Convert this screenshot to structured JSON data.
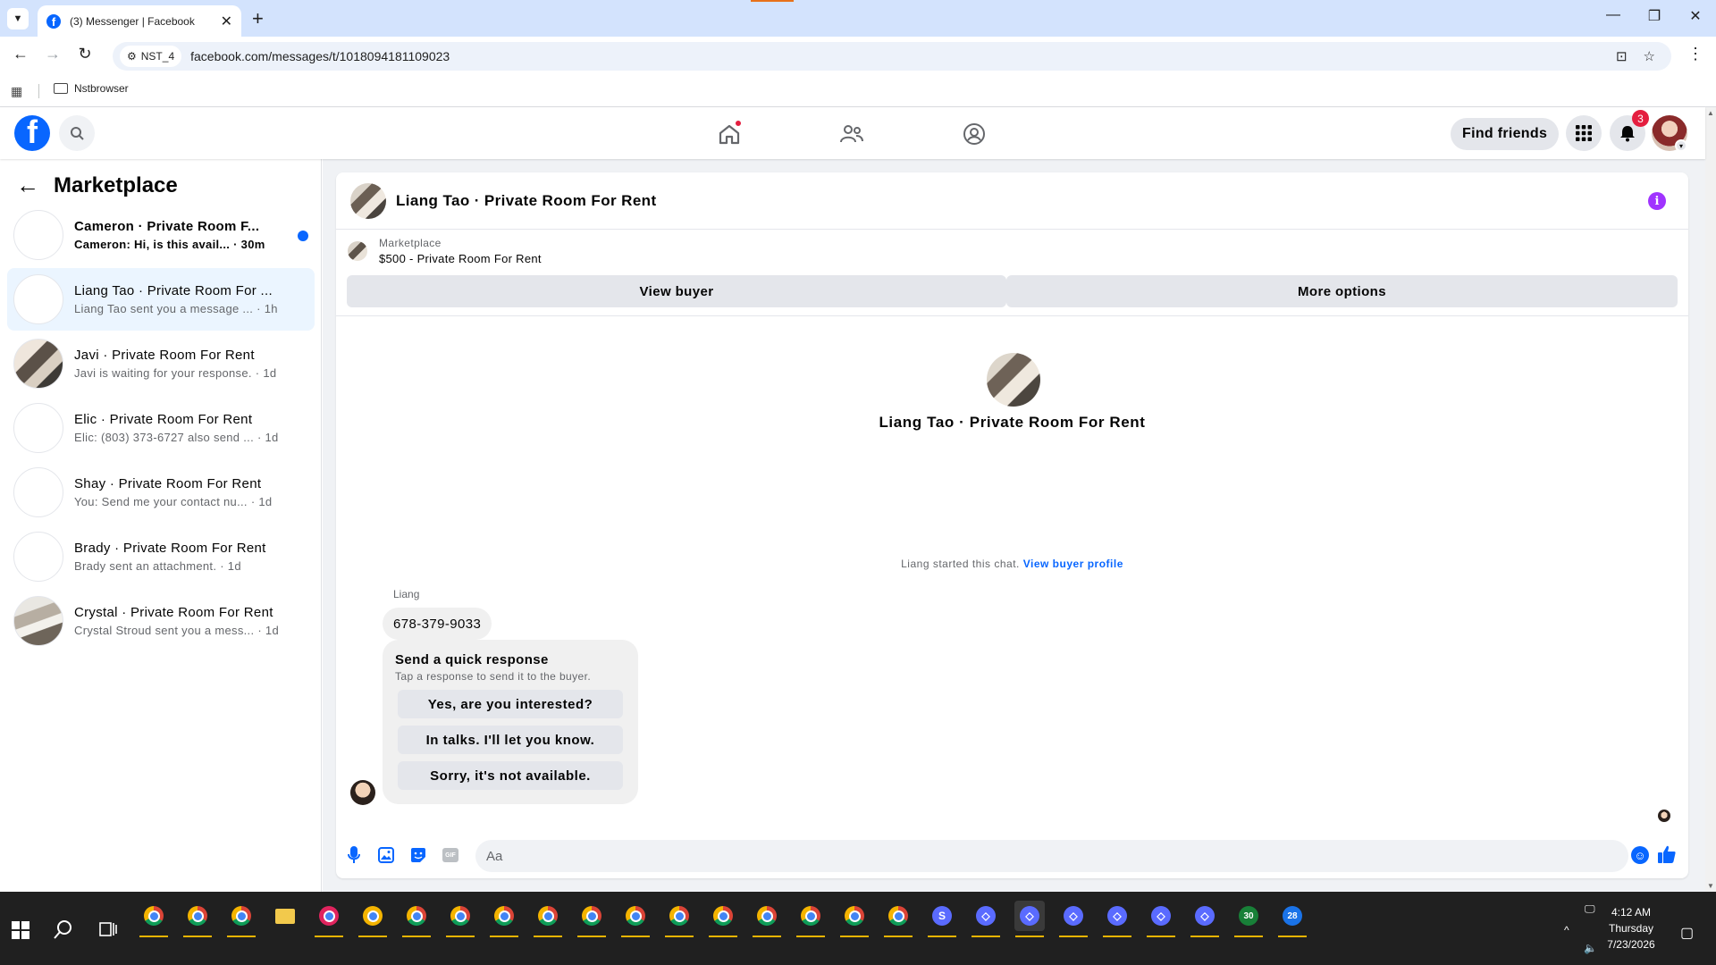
{
  "browser": {
    "tab_title": "(3) Messenger | Facebook",
    "profile_chip": "NST_4",
    "url": "facebook.com/messages/t/1018094181109023",
    "bookmark": "Nstbrowser",
    "icons": {
      "back": "arrow-left-icon",
      "forward": "arrow-right-icon",
      "reload": "reload-icon",
      "install": "install-app-icon",
      "bookmark_star": "star-icon",
      "menu": "kebab-menu-icon"
    }
  },
  "fb_header": {
    "find_friends": "Find friends",
    "notification_count": "3",
    "brand_color": "#0866ff",
    "badge_color": "#e41e3f"
  },
  "sidebar": {
    "title": "Marketplace",
    "conversations": [
      {
        "name": "Cameron · Private Room F...",
        "preview": "Cameron: Hi, is this avail...",
        "time": "· 30m",
        "unread": true
      },
      {
        "name": "Liang Tao · Private Room For ...",
        "preview": "Liang Tao sent you a message ...",
        "time": "· 1h",
        "active": true
      },
      {
        "name": "Javi · Private Room For Rent",
        "preview": "Javi is waiting for your response.",
        "time": "· 1d"
      },
      {
        "name": "Elic · Private Room For Rent",
        "preview": "Elic: (803) 373-6727 also send ...",
        "time": "· 1d"
      },
      {
        "name": "Shay · Private Room For Rent",
        "preview": "You: Send me your contact nu...",
        "time": "· 1d"
      },
      {
        "name": "Brady · Private Room For Rent",
        "preview": "Brady sent an attachment.",
        "time": "· 1d"
      },
      {
        "name": "Crystal · Private Room For Rent",
        "preview": "Crystal Stroud sent you a mess...",
        "time": "· 1d"
      }
    ]
  },
  "chat": {
    "header_title": "Liang Tao · Private Room For Rent",
    "listing_label": "Marketplace",
    "listing_price": "$500 - Private Room For Rent",
    "view_buyer": "View buyer",
    "more_options": "More options",
    "intro_name": "Liang Tao · Private Room For Rent",
    "started_text": "Liang started this chat.",
    "started_link": "View buyer profile",
    "sender_name": "Liang",
    "message": "678-379-9033",
    "quick_response": {
      "title": "Send a quick response",
      "subtitle": "Tap a response to send it to the buyer.",
      "options": [
        "Yes, are you interested?",
        "In talks. I'll let you know.",
        "Sorry, it's not available."
      ]
    },
    "composer_placeholder": "Aa",
    "accent_color": "#0866ff",
    "info_color": "#a033ff"
  },
  "taskbar": {
    "badges": [
      "30",
      "28"
    ],
    "time": "4:12 AM",
    "day": "Thursday",
    "date": "7/23/2026"
  }
}
